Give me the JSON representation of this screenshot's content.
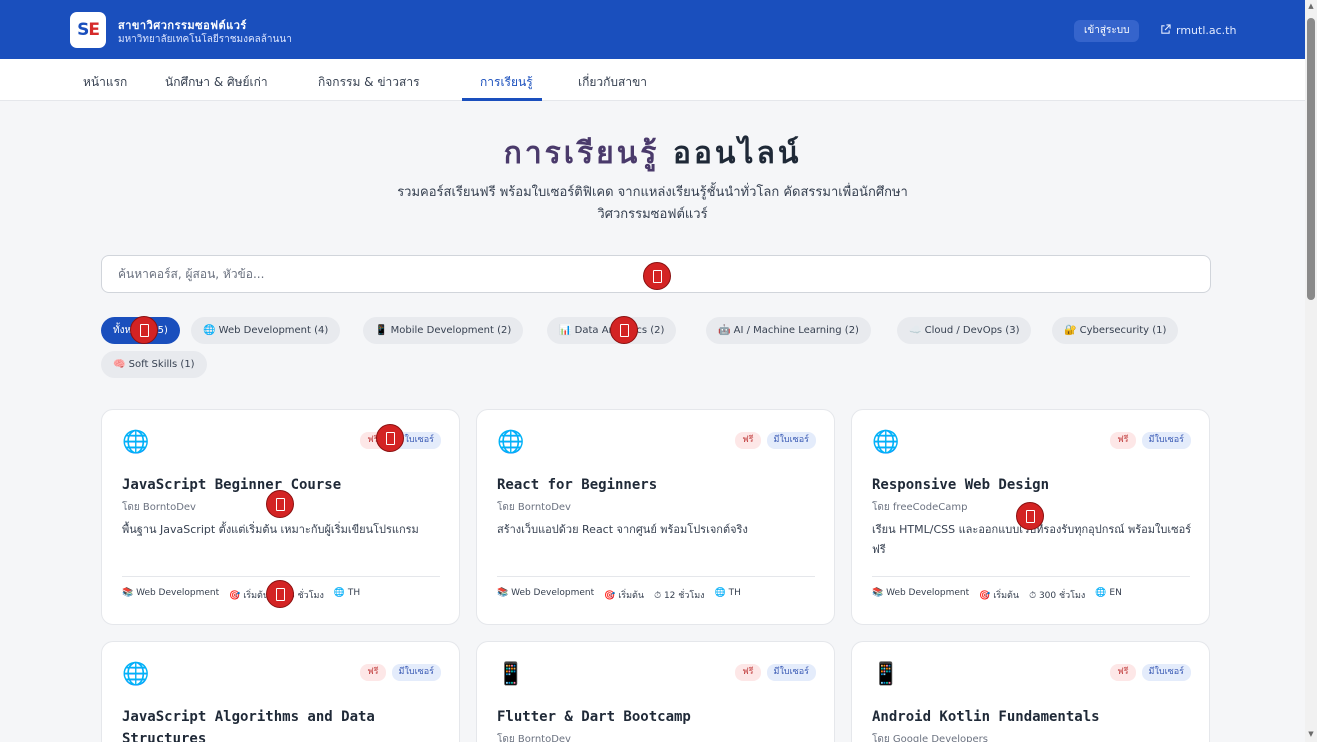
{
  "header": {
    "logo_s": "S",
    "logo_e": "E",
    "brand_name": "สาขาวิศวกรรมซอฟต์แวร์",
    "brand_sub": "มหาวิทยาลัยเทคโนโลยีราชมงคลล้านนา",
    "login_label": "เข้าสู่ระบบ",
    "ext_link_label": "rmutl.ac.th",
    "ext_icon": "external-link-icon",
    "bg_color": "#1a4fbd"
  },
  "nav": {
    "items": [
      {
        "label": "หน้าแรก",
        "active": false
      },
      {
        "label": "นักศึกษา & ศิษย์เก่า",
        "active": false
      },
      {
        "label": "กิจกรรม & ข่าวสาร",
        "active": false
      },
      {
        "label": "การเรียนรู้",
        "active": true
      },
      {
        "label": "เกี่ยวกับสาขา",
        "active": false
      }
    ]
  },
  "hero": {
    "title_part1": "การเรียนรู้",
    "title_part2": "ออนไลน์",
    "desc_line1": "รวมคอร์สเรียนฟรี พร้อมใบเซอร์ติฟิเคด จากแหล่งเรียนรู้ชั้นนำทั่วโลก คัดสรรมาเพื่อนักศึกษา",
    "desc_line2": "วิศวกรรมซอฟต์แวร์"
  },
  "search": {
    "placeholder": "ค้นหาคอร์ส, ผู้สอน, หัวข้อ..."
  },
  "filters": [
    {
      "label": "ทั้งหมด (15)",
      "active": true,
      "icon": ""
    },
    {
      "label": "Web Development (4)",
      "active": false,
      "icon": "🌐"
    },
    {
      "label": "Mobile Development (2)",
      "active": false,
      "icon": "📱"
    },
    {
      "label": "Data Analytics (2)",
      "active": false,
      "icon": "📊"
    },
    {
      "label": "AI / Machine Learning (2)",
      "active": false,
      "icon": "🤖"
    },
    {
      "label": "Cloud / DevOps (3)",
      "active": false,
      "icon": "☁️"
    },
    {
      "label": "Cybersecurity (1)",
      "active": false,
      "icon": "🔐"
    },
    {
      "label": "Soft Skills (1)",
      "active": false,
      "icon": "🧠"
    }
  ],
  "courses": [
    {
      "icon": "🌐",
      "icon_name": "globe-icon",
      "tag_free": "ฟรี",
      "tag_cert": "มีใบเซอร์",
      "title": "JavaScript Beginner Course",
      "author": "โดย BorntoDev",
      "desc": "พื้นฐาน JavaScript ตั้งแต่เริ่มต้น เหมาะกับผู้เริ่มเขียนโปรแกรม",
      "category": "📚 Web Development",
      "level": "🎯 เริ่มต้น",
      "duration": "⏱ 8 ชั่วโมง",
      "lang": "🌐 TH"
    },
    {
      "icon": "🌐",
      "icon_name": "globe-icon",
      "tag_free": "ฟรี",
      "tag_cert": "มีใบเซอร์",
      "title": "React for Beginners",
      "author": "โดย BorntoDev",
      "desc": "สร้างเว็บแอปด้วย React จากศูนย์ พร้อมโปรเจกต์จริง",
      "category": "📚 Web Development",
      "level": "🎯 เริ่มต้น",
      "duration": "⏱ 12 ชั่วโมง",
      "lang": "🌐 TH"
    },
    {
      "icon": "🌐",
      "icon_name": "globe-icon",
      "tag_free": "ฟรี",
      "tag_cert": "มีใบเซอร์",
      "title": "Responsive Web Design",
      "author": "โดย freeCodeCamp",
      "desc": "เรียน HTML/CSS และออกแบบเว็บที่รองรับทุกอุปกรณ์ พร้อมใบเซอร์ฟรี",
      "category": "📚 Web Development",
      "level": "🎯 เริ่มต้น",
      "duration": "⏱ 300 ชั่วโมง",
      "lang": "🌐 EN"
    },
    {
      "icon": "🌐",
      "icon_name": "globe-icon",
      "tag_free": "ฟรี",
      "tag_cert": "มีใบเซอร์",
      "title": "JavaScript Algorithms and Data Structures",
      "author": "",
      "desc": "",
      "category": "",
      "level": "",
      "duration": "",
      "lang": ""
    },
    {
      "icon": "📱",
      "icon_name": "phone-icon",
      "tag_free": "ฟรี",
      "tag_cert": "มีใบเซอร์",
      "title": "Flutter & Dart Bootcamp",
      "author": "โดย BorntoDev",
      "desc": "",
      "category": "",
      "level": "",
      "duration": "",
      "lang": ""
    },
    {
      "icon": "📱",
      "icon_name": "phone-icon",
      "tag_free": "ฟรี",
      "tag_cert": "มีใบเซอร์",
      "title": "Android Kotlin Fundamentals",
      "author": "โดย Google Developers",
      "desc": "",
      "category": "",
      "level": "",
      "duration": "",
      "lang": ""
    }
  ]
}
